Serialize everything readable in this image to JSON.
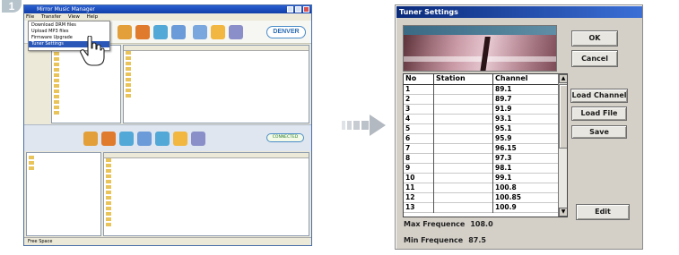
{
  "step_number": "1",
  "left_window": {
    "title": "Mirror Music Manager",
    "menu": [
      "File",
      "Transfer",
      "View",
      "Help"
    ],
    "dropdown_items": [
      "Download DRM files",
      "Upload MP3 files",
      "Firmware Upgrade",
      "Tuner Settings"
    ],
    "logo_text": "DENVER",
    "connect_label": "CONNECTED",
    "status_text": "Free Space"
  },
  "dialog": {
    "title": "Tuner Settings",
    "buttons": {
      "ok": "OK",
      "cancel": "Cancel",
      "load_channel": "Load Channel",
      "load_file": "Load File",
      "save": "Save",
      "edit": "Edit"
    },
    "columns": [
      "No",
      "Station",
      "Channel"
    ],
    "rows": [
      {
        "no": "1",
        "station": "",
        "channel": "89.1"
      },
      {
        "no": "2",
        "station": "",
        "channel": "89.7"
      },
      {
        "no": "3",
        "station": "",
        "channel": "91.9"
      },
      {
        "no": "4",
        "station": "",
        "channel": "93.1"
      },
      {
        "no": "5",
        "station": "",
        "channel": "95.1"
      },
      {
        "no": "6",
        "station": "",
        "channel": "95.9"
      },
      {
        "no": "7",
        "station": "",
        "channel": "96.15"
      },
      {
        "no": "8",
        "station": "",
        "channel": "97.3"
      },
      {
        "no": "9",
        "station": "",
        "channel": "98.1"
      },
      {
        "no": "10",
        "station": "",
        "channel": "99.1"
      },
      {
        "no": "11",
        "station": "",
        "channel": "100.8"
      },
      {
        "no": "12",
        "station": "",
        "channel": "100.85"
      },
      {
        "no": "13",
        "station": "",
        "channel": "100.9"
      }
    ],
    "max_freq_label": "Max Frequence",
    "max_freq_value": "108.0",
    "min_freq_label": "Min Frequence",
    "min_freq_value": "87.5"
  },
  "colors": {
    "dialog_bg": "#d4d0c8",
    "title_bar": "#0a2a7a",
    "arrow": "#bfc4ca"
  }
}
